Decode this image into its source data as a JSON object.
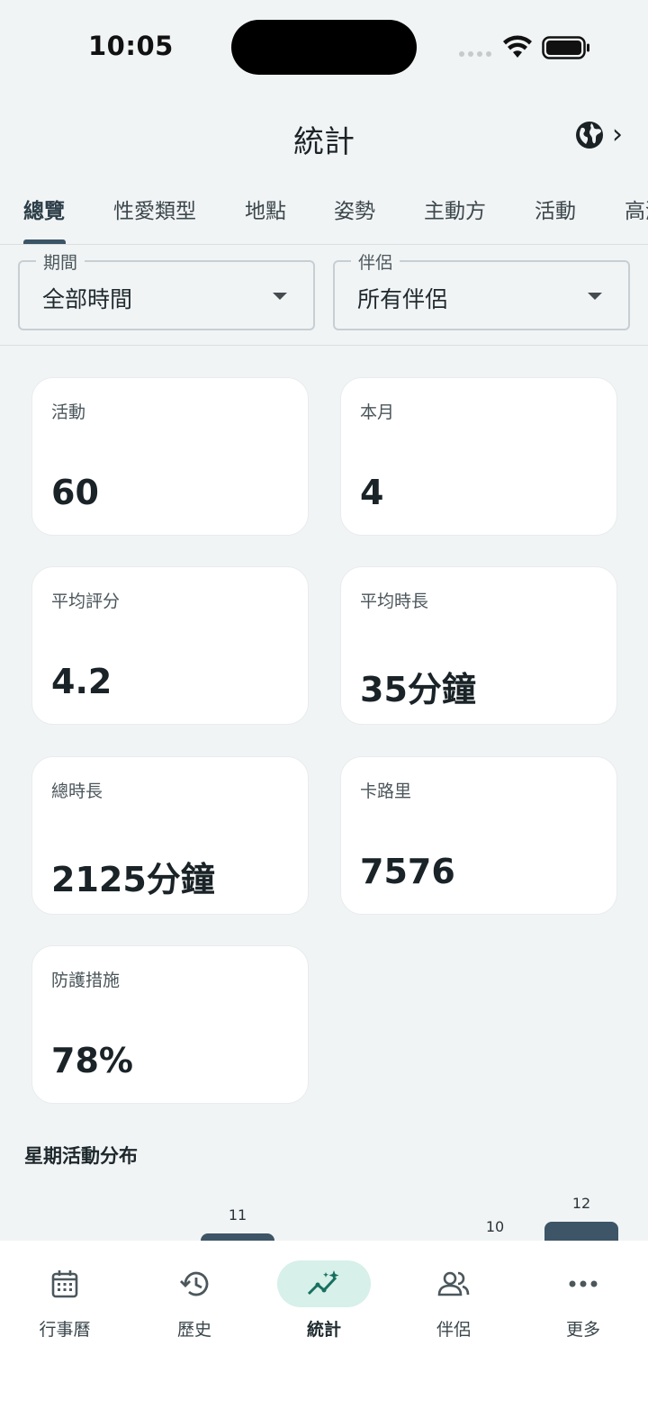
{
  "status_bar": {
    "time": "10:05"
  },
  "header": {
    "title": "統計",
    "globe_chevron": "›"
  },
  "tabs": [
    {
      "label": "總覽",
      "active": true
    },
    {
      "label": "性愛類型"
    },
    {
      "label": "地點"
    },
    {
      "label": "姿勢"
    },
    {
      "label": "主動方"
    },
    {
      "label": "活動"
    },
    {
      "label": "高潮"
    }
  ],
  "filters": {
    "period": {
      "label": "期間",
      "value": "全部時間"
    },
    "partner": {
      "label": "伴侶",
      "value": "所有伴侶"
    }
  },
  "stats": [
    {
      "label": "活動",
      "value": "60"
    },
    {
      "label": "本月",
      "value": "4"
    },
    {
      "label": "平均評分",
      "value": "4.2"
    },
    {
      "label": "平均時長",
      "value": "35分鐘"
    },
    {
      "label": "總時長",
      "value": "2125分鐘"
    },
    {
      "label": "卡路里",
      "value": "7576"
    },
    {
      "label": "防護措施",
      "value": "78%"
    }
  ],
  "weekday_section": {
    "title": "星期活動分布"
  },
  "chart_data": {
    "type": "bar",
    "values": [
      11,
      10,
      12
    ],
    "value_labels": [
      "11",
      "10",
      "12"
    ]
  },
  "colors": {
    "accent": "#3d5566",
    "active_nav_bg": "#d7f0e9",
    "background": "#f1f4f5"
  },
  "bottom_nav": [
    {
      "label": "行事曆",
      "icon": "calendar-icon"
    },
    {
      "label": "歷史",
      "icon": "history-icon"
    },
    {
      "label": "統計",
      "icon": "stats-icon",
      "active": true
    },
    {
      "label": "伴侶",
      "icon": "partners-icon"
    },
    {
      "label": "更多",
      "icon": "more-icon"
    }
  ]
}
